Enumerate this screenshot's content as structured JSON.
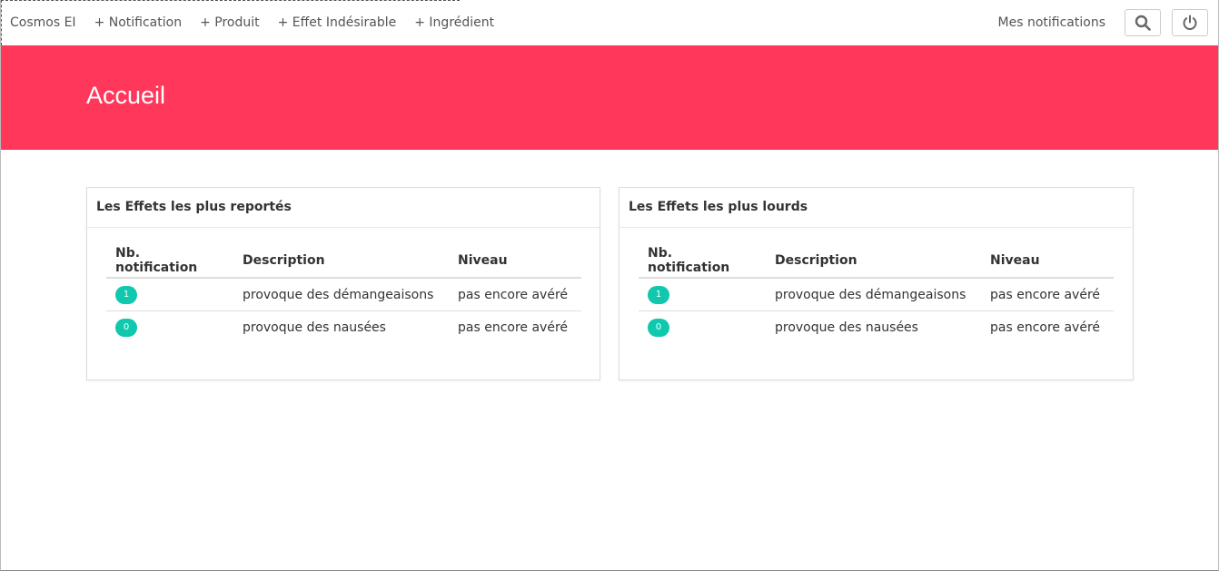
{
  "navbar": {
    "brand": "Cosmos EI",
    "links": [
      "+ Notification",
      "+ Produit",
      "+ Effet Indésirable",
      "+ Ingrédient"
    ],
    "my_notifications": "Mes notifications",
    "search_icon": "search-icon",
    "power_icon": "power-icon"
  },
  "hero": {
    "title": "Accueil",
    "color": "#ff375b"
  },
  "panels": [
    {
      "title": "Les Effets les plus reportés",
      "headers": [
        "Nb. notification",
        "Description",
        "Niveau"
      ],
      "rows": [
        {
          "count": "1",
          "description": "provoque des démangeaisons",
          "level": "pas encore avéré"
        },
        {
          "count": "0",
          "description": "provoque des nausées",
          "level": "pas encore avéré"
        }
      ]
    },
    {
      "title": "Les Effets les plus lourds",
      "headers": [
        "Nb. notification",
        "Description",
        "Niveau"
      ],
      "rows": [
        {
          "count": "1",
          "description": "provoque des démangeaisons",
          "level": "pas encore avéré"
        },
        {
          "count": "0",
          "description": "provoque des nausées",
          "level": "pas encore avéré"
        }
      ]
    }
  ],
  "badge_color": "#10c8ad"
}
